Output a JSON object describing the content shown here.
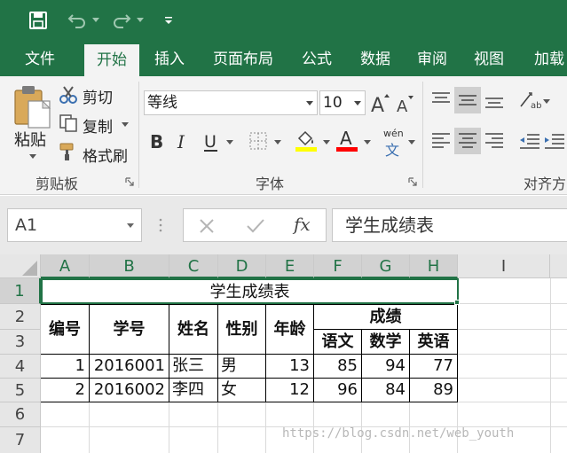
{
  "quick_access": {
    "icons": [
      "save-icon",
      "undo-icon",
      "redo-icon",
      "customize-icon"
    ]
  },
  "tabs": [
    "文件",
    "开始",
    "插入",
    "页面布局",
    "公式",
    "数据",
    "审阅",
    "视图",
    "加载"
  ],
  "active_tab": "开始",
  "ribbon": {
    "clipboard": {
      "label": "剪贴板",
      "paste": "粘贴",
      "cut": "剪切",
      "copy": "复制",
      "format_painter": "格式刷"
    },
    "font": {
      "label": "字体",
      "font_name": "等线",
      "font_size": "10",
      "wen_top": "wén",
      "wen_bottom": "文"
    },
    "alignment": {
      "label": "对齐方"
    },
    "colors": {
      "highlight": "#ffff00",
      "font_color": "#ff0000"
    }
  },
  "formula_bar": {
    "name_box": "A1",
    "fx": "fx",
    "content": "学生成绩表"
  },
  "grid": {
    "columns": [
      "A",
      "B",
      "C",
      "D",
      "E",
      "F",
      "G",
      "H",
      "I"
    ],
    "rows": [
      "1",
      "2",
      "3",
      "4",
      "5",
      "6",
      "7"
    ],
    "title": "学生成绩表",
    "headers": {
      "id": "编号",
      "student_no": "学号",
      "name": "姓名",
      "gender": "性别",
      "age": "年龄",
      "scores": "成绩",
      "chinese": "语文",
      "math": "数学",
      "english": "英语"
    },
    "records": [
      {
        "id": "1",
        "student_no": "2016001",
        "name": "张三",
        "gender": "男",
        "age": "13",
        "chinese": "85",
        "math": "94",
        "english": "77"
      },
      {
        "id": "2",
        "student_no": "2016002",
        "name": "李四",
        "gender": "女",
        "age": "12",
        "chinese": "96",
        "math": "84",
        "english": "89"
      }
    ]
  },
  "watermark": "https://blog.csdn.net/web_youth",
  "accent_color": "#217346"
}
